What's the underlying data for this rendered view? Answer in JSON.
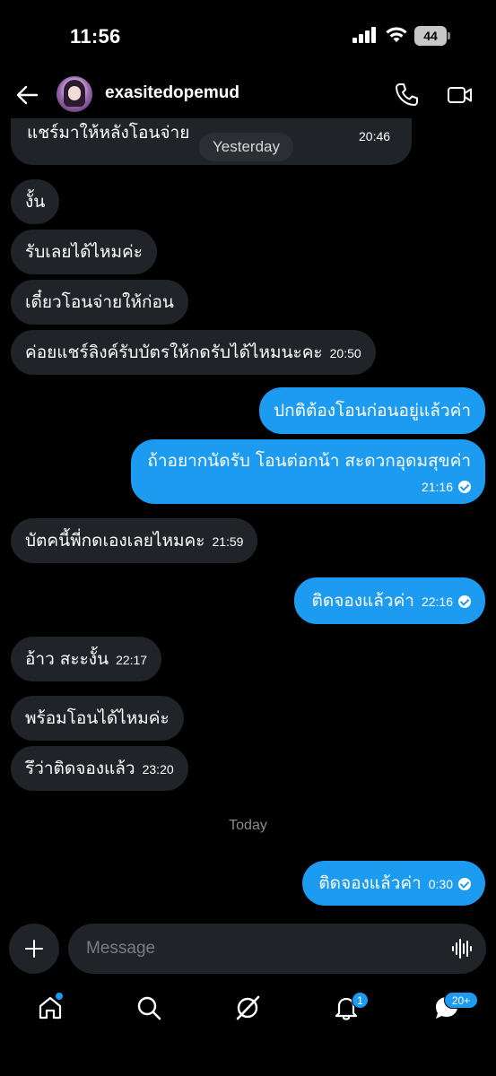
{
  "status_bar": {
    "time": "11:56",
    "battery": "44"
  },
  "header": {
    "username": "exasitedopemud"
  },
  "chat": {
    "partial_bubble": {
      "line2": "แชร์มาให้หลังโอนจ่าย",
      "time": "20:46",
      "date_pill": "Yesterday"
    },
    "messages": [
      {
        "dir": "in",
        "text": "งั้น",
        "time": ""
      },
      {
        "dir": "in",
        "text": "รับเลยได้ไหมค่ะ",
        "time": ""
      },
      {
        "dir": "in",
        "text": "เดี๋ยวโอนจ่ายให้ก่อน",
        "time": ""
      },
      {
        "dir": "in",
        "text": "ค่อยแชร์ลิงค์รับบัตรให้กดรับได้ไหมนะคะ",
        "time": "20:50"
      },
      {
        "dir": "out",
        "text": "ปกติต้องโอนก่อนอยู่แล้วค่า",
        "time": ""
      },
      {
        "dir": "out",
        "text": "ถ้าอยากนัดรับ โอนต่อกน้า สะดวกอุดมสุขค่า",
        "time": "21:16"
      },
      {
        "dir": "in",
        "text": "บัตคนี้พี่กดเองเลยไหมคะ",
        "time": "21:59"
      },
      {
        "dir": "out",
        "text": "ติดจองแล้วค่า",
        "time": "22:16"
      },
      {
        "dir": "in",
        "text": "อ้าว สะะงั้น",
        "time": "22:17"
      },
      {
        "dir": "in",
        "text": "พร้อมโอนได้ไหมค่ะ",
        "time": ""
      },
      {
        "dir": "in",
        "text": "รึว่าติดจองแล้ว",
        "time": "23:20"
      },
      {
        "dir": "out",
        "text": "ติดจองแล้วค่า",
        "time": "0:30"
      }
    ],
    "today_label": "Today"
  },
  "composer": {
    "placeholder": "Message"
  },
  "tabbar": {
    "notifications_badge": "1",
    "messages_badge": "20+"
  },
  "colors": {
    "accent": "#1d9bf0",
    "incoming_bubble": "#202327",
    "background": "#000000"
  }
}
